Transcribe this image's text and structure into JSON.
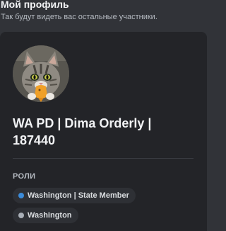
{
  "header": {
    "title": "Мой профиль",
    "subtitle": "Так будут видеть вас остальные участники."
  },
  "profile": {
    "avatar": "cat-holding-orange-fish",
    "display_name": "WA PD | Dima Orderly | 187440"
  },
  "roles": {
    "heading": "РОЛИ",
    "items": [
      {
        "name": "Washington | State Member",
        "color": "#3b8bd9"
      },
      {
        "name": "Washington",
        "color": "#a9afb7"
      }
    ]
  },
  "colors": {
    "background": "#313338",
    "card": "#232428",
    "pill": "#2e3035"
  }
}
